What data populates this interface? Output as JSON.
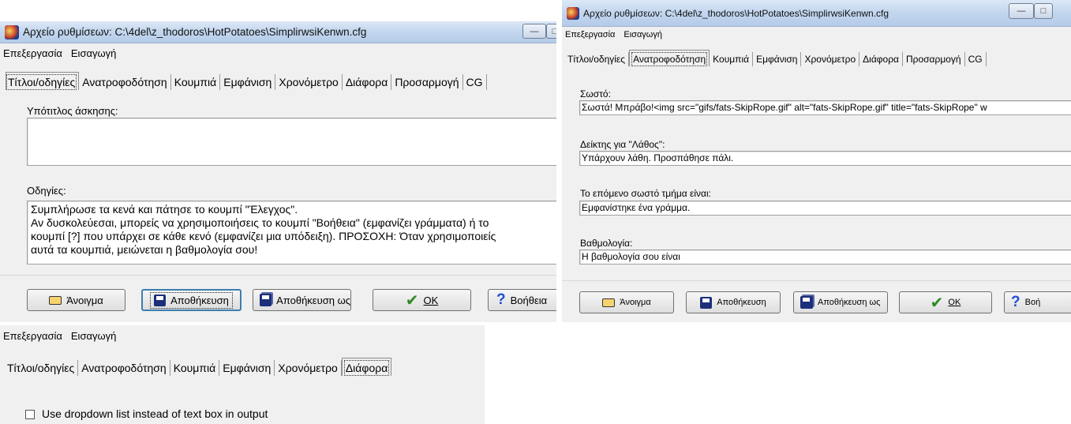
{
  "window_left": {
    "title": "Αρχείο ρυθμίσεων:  C:\\4del\\z_thodoros\\HotPotatoes\\SimplirwsiKenwn.cfg",
    "menu": [
      "Επεξεργασία",
      "Εισαγωγή"
    ],
    "tabs": [
      "Τίτλοι/οδηγίες",
      "Ανατροφοδότηση",
      "Κουμπιά",
      "Εμφάνιση",
      "Χρονόμετρο",
      "Διάφορα",
      "Προσαρμογή",
      "CG"
    ],
    "active_tab": "Τίτλοι/οδηγίες",
    "subtitle_label": "Υπότιτλος άσκησης:",
    "subtitle_value": "",
    "instructions_label": "Οδηγίες:",
    "instructions_lines": [
      "Συμπλήρωσε τα κενά και πάτησε το κουμπί \"Έλεγχος\".",
      "Αν δυσκολεύεσαι, μπορείς να χρησιμοποιήσεις το κουμπί \"Βοήθεια\" (εμφανίζει γράμματα) ή το",
      "κουμπί [?] που υπάρχει σε κάθε κενό (εμφανίζει μια υπόδειξη). ΠΡΟΣΟΧΗ: Όταν χρησιμοποιείς",
      "αυτά τα κουμπιά, μειώνεται η βαθμολογία σου!"
    ],
    "buttons": {
      "open": "Άνοιγμα",
      "save": "Αποθήκευση",
      "save_as": "Αποθήκευση ως",
      "ok": "OK",
      "help": "Βοήθεια"
    }
  },
  "window_right": {
    "title": "Αρχείο ρυθμίσεων:  C:\\4del\\z_thodoros\\HotPotatoes\\SimplirwsiKenwn.cfg",
    "menu": [
      "Επεξεργασία",
      "Εισαγωγή"
    ],
    "tabs": [
      "Τίτλοι/οδηγίες",
      "Ανατροφοδότηση",
      "Κουμπιά",
      "Εμφάνιση",
      "Χρονόμετρο",
      "Διάφορα",
      "Προσαρμογή",
      "CG"
    ],
    "active_tab": "Ανατροφοδότηση",
    "correct_label": "Σωστό:",
    "correct_value": "Σωστά! Μπράβο!<img src=\"gifs/fats-SkipRope.gif\" alt=\"fats-SkipRope.gif\" title=\"fats-SkipRope\" w",
    "wrong_label": "Δείκτης για \"Λάθος\":",
    "wrong_value": "Υπάρχουν λάθη. Προσπάθησε πάλι.",
    "next_label": "Το επόμενο σωστό τμήμα είναι:",
    "next_value": "Εμφανίστηκε ένα γράμμα.",
    "score_label": "Βαθμολογία:",
    "score_value": "Η βαθμολογία σου είναι",
    "buttons": {
      "open": "Άνοιγμα",
      "save": "Αποθήκευση",
      "save_as": "Αποθήκευση ως",
      "ok": "OK",
      "help": "Βοή"
    }
  },
  "window_bottom": {
    "menu": [
      "Επεξεργασία",
      "Εισαγωγή"
    ],
    "tabs": [
      "Τίτλοι/οδηγίες",
      "Ανατροφοδότηση",
      "Κουμπιά",
      "Εμφάνιση",
      "Χρονόμετρο",
      "Διάφορα"
    ],
    "active_tab": "Διάφορα",
    "checkbox_label": "Use dropdown list instead of text box in output",
    "checkbox_checked": false
  },
  "icons": {
    "app": "hot-potatoes-icon",
    "open": "folder-open-icon",
    "save": "floppy-disk-icon",
    "save_as": "floppy-disks-icon",
    "ok": "checkmark-icon",
    "help": "help-question-icon",
    "minimize": "minimize-icon",
    "maximize": "maximize-icon"
  },
  "colors": {
    "dialog_bg": "#f0f0f0",
    "field_bg": "#ffffff",
    "titlebar": "#c2d6ee",
    "ok_check": "#2e8b22",
    "help_mark": "#1f4fd6"
  }
}
